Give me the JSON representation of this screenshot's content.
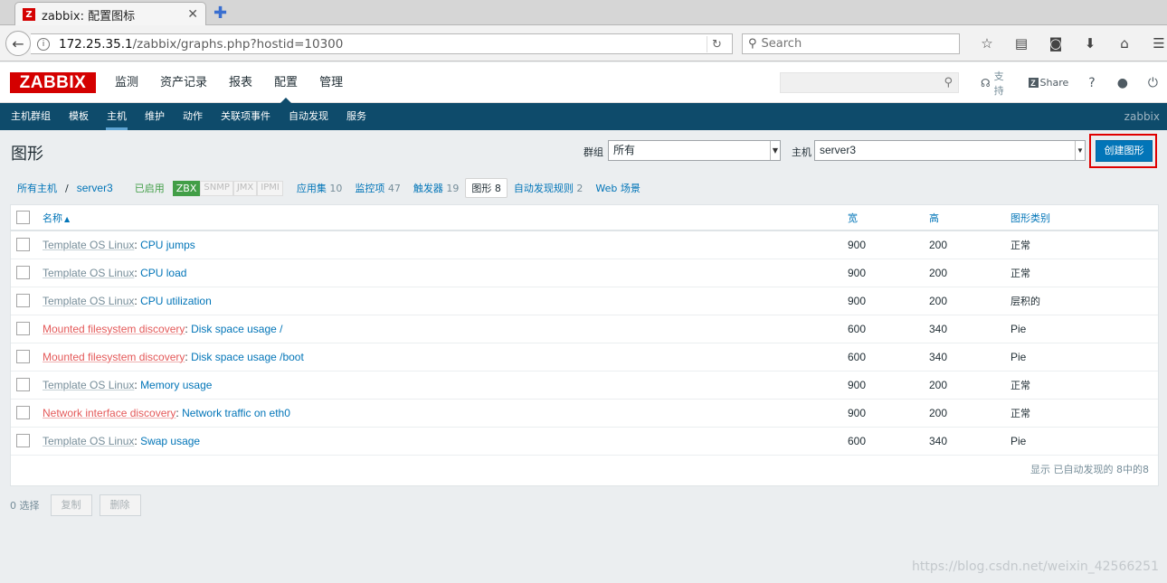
{
  "browser": {
    "tab_title": "zabbix: 配置图标",
    "tab_close": "✕",
    "new_tab": "✚",
    "url_host": "172.25.35.1",
    "url_path": "/zabbix/graphs.php?hostid=10300",
    "search_placeholder": "Search"
  },
  "header": {
    "logo": "ZABBIX",
    "menu": [
      "监测",
      "资产记录",
      "报表",
      "配置",
      "管理"
    ],
    "active_menu": "配置",
    "support": "支持",
    "share": "Share",
    "help": "?",
    "share_z": "Z"
  },
  "submenu": {
    "items": [
      "主机群组",
      "模板",
      "主机",
      "维护",
      "动作",
      "关联项事件",
      "自动发现",
      "服务"
    ],
    "active": "主机",
    "brand": "zabbix"
  },
  "page": {
    "title": "图形",
    "group_label": "群组",
    "group_value": "所有",
    "host_label": "主机",
    "host_value": "server3",
    "create_button": "创建图形"
  },
  "hostnav": {
    "all_hosts": "所有主机",
    "separator": "/",
    "host": "server3",
    "status": "已启用",
    "availability": [
      "ZBX",
      "SNMP",
      "JMX",
      "IPMI"
    ],
    "applications": {
      "label": "应用集",
      "count": "10"
    },
    "items": {
      "label": "监控项",
      "count": "47"
    },
    "triggers": {
      "label": "触发器",
      "count": "19"
    },
    "graphs": {
      "label": "图形",
      "count": "8"
    },
    "discovery": {
      "label": "自动发现规则",
      "count": "2"
    },
    "web": "Web 场景"
  },
  "table": {
    "headers": {
      "name": "名称",
      "width": "宽",
      "height": "高",
      "type": "图形类别"
    },
    "sort_arrow": "▲",
    "rows": [
      {
        "prefix": "Template OS Linux",
        "prefix_type": "template",
        "name": "CPU jumps",
        "width": "900",
        "height": "200",
        "type": "正常"
      },
      {
        "prefix": "Template OS Linux",
        "prefix_type": "template",
        "name": "CPU load",
        "width": "900",
        "height": "200",
        "type": "正常"
      },
      {
        "prefix": "Template OS Linux",
        "prefix_type": "template",
        "name": "CPU utilization",
        "width": "900",
        "height": "200",
        "type": "层积的"
      },
      {
        "prefix": "Mounted filesystem discovery",
        "prefix_type": "discovery",
        "name": "Disk space usage /",
        "width": "600",
        "height": "340",
        "type": "Pie"
      },
      {
        "prefix": "Mounted filesystem discovery",
        "prefix_type": "discovery",
        "name": "Disk space usage /boot",
        "width": "600",
        "height": "340",
        "type": "Pie"
      },
      {
        "prefix": "Template OS Linux",
        "prefix_type": "template",
        "name": "Memory usage",
        "width": "900",
        "height": "200",
        "type": "正常"
      },
      {
        "prefix": "Network interface discovery",
        "prefix_type": "discovery",
        "name": "Network traffic on eth0",
        "width": "900",
        "height": "200",
        "type": "正常"
      },
      {
        "prefix": "Template OS Linux",
        "prefix_type": "template",
        "name": "Swap usage",
        "width": "600",
        "height": "340",
        "type": "Pie"
      }
    ],
    "footer": "显示 已自动发现的 8中的8"
  },
  "actions": {
    "selected": "0 选择",
    "copy": "复制",
    "delete": "删除"
  },
  "watermark": "https://blog.csdn.net/weixin_42566251",
  "colors": {
    "brand_red": "#d40000",
    "nav_blue": "#0e4b6b",
    "link_blue": "#0275b8",
    "discovery_orange": "#e45959",
    "enabled_green": "#429e47"
  }
}
